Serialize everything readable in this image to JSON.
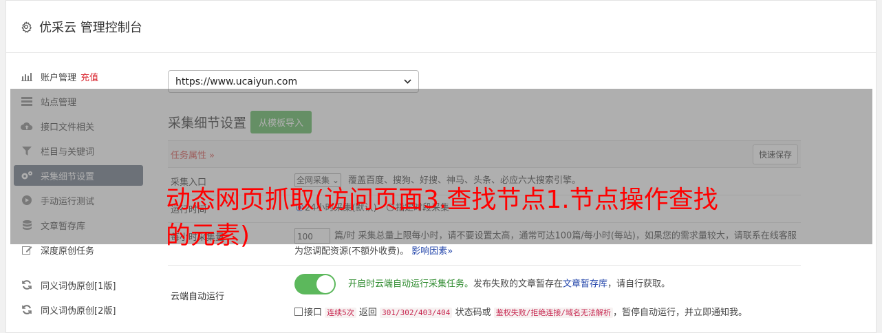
{
  "header": {
    "title": "优采云 管理控制台",
    "icon": "gear-icon"
  },
  "sidebar": {
    "items": [
      {
        "label": "账户管理",
        "tag": "充值",
        "icon": "bar-chart-icon"
      },
      {
        "label": "站点管理",
        "icon": "server-icon"
      },
      {
        "label": "接口文件相关",
        "icon": "cloud-upload-icon"
      },
      {
        "label": "栏目与关键词",
        "icon": "filter-icon"
      },
      {
        "label": "采集细节设置",
        "icon": "gears-icon",
        "active": true
      },
      {
        "label": "手动运行测试",
        "icon": "play-icon"
      },
      {
        "label": "文章暂存库",
        "icon": "database-icon"
      },
      {
        "label": "深度原创任务",
        "icon": "edit-icon"
      },
      {
        "label": "同义词伪原创[1版]",
        "icon": "refresh-icon"
      },
      {
        "label": "同义词伪原创[2版]",
        "icon": "refresh-icon"
      }
    ]
  },
  "main": {
    "site_select": "https://www.ucaiyun.com",
    "section_title": "采集细节设置",
    "import_button": "从模板导入",
    "task_attr": "任务属性",
    "task_attr_arrow": "»",
    "quick_save": "快速保存",
    "rows": {
      "entry": {
        "label": "采集入口",
        "select": "全网采集",
        "desc": "覆盖百度、搜狗、好搜、神马、头条、必应六大搜索引擎。"
      },
      "run_time": {
        "label": "运行时间",
        "opt1": "24小时采集(默认)",
        "opt2": "指定时段采集"
      },
      "collect": {
        "label": "每小时采集量",
        "value": "100",
        "desc": "篇/时 采集总量上限每小时，请不要设置太高，通常可达100篇/每小时(每站)，如果您的需求量较大，请联系在线客服为您调配资源(不额外收费)。",
        "link": "影响因素»"
      },
      "cloud": {
        "label": "云端自动运行",
        "status": "开启时云端自动运行采集任务。",
        "desc_pre": "发布失败的文章暂存在",
        "desc_link": "文章暂存库",
        "desc_post": "，请自行获取。",
        "chk_pre": "接口",
        "code1": "连续5次",
        "mid1": "返回",
        "code2": "301/302/403/404",
        "mid2": "状态码或",
        "code3": "鉴权失败/拒绝连接/域名无法解析",
        "chk_post": "，暂停自动运行，并立即通知我。"
      }
    }
  },
  "overlay": {
    "text": "动态网页抓取(访问页面3.查找节点1.节点操作查找的元素)"
  }
}
